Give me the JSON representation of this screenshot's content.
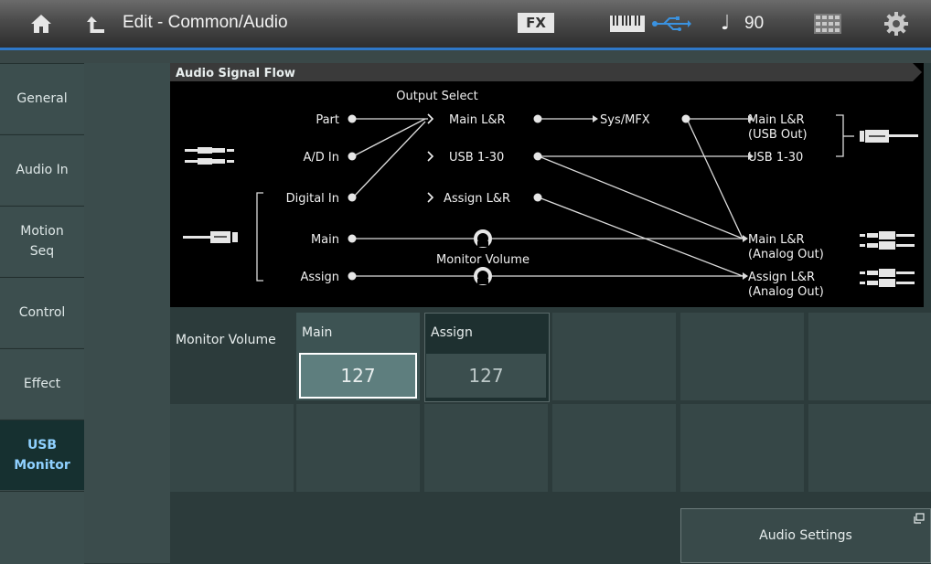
{
  "header": {
    "title": "Edit - Common/Audio",
    "fx_label": "FX",
    "tempo_note": "♩",
    "tempo": "90"
  },
  "sidebar": {
    "tabs": [
      {
        "label": "General"
      },
      {
        "label": "Audio In"
      },
      {
        "label": "Motion\nSeq"
      },
      {
        "label": "Control"
      },
      {
        "label": "Effect"
      },
      {
        "label": "USB\nMonitor",
        "active": true
      }
    ]
  },
  "flow": {
    "title": "Audio Signal Flow",
    "output_select": "Output Select",
    "inputs": [
      "Part",
      "A/D In",
      "Digital In",
      "Main",
      "Assign"
    ],
    "outputs": [
      "Main L&R",
      "USB 1-30",
      "Assign L&R"
    ],
    "sysmfx": "Sys/MFX",
    "usb_out": {
      "line1": "Main L&R",
      "line2": "(USB Out)"
    },
    "usb_1_30": "USB 1-30",
    "analog_main": {
      "line1": "Main L&R",
      "line2": "(Analog Out)"
    },
    "analog_assign": {
      "line1": "Assign L&R",
      "line2": "(Analog Out)"
    },
    "monitor_volume": "Monitor Volume"
  },
  "params": {
    "row_label": "Monitor Volume",
    "main": {
      "label": "Main",
      "value": "127"
    },
    "assign": {
      "label": "Assign",
      "value": "127"
    }
  },
  "footer": {
    "audio_settings": "Audio Settings"
  },
  "colors": {
    "accent_blue": "#2f78c8",
    "active_tab_text": "#8fd0ff"
  }
}
